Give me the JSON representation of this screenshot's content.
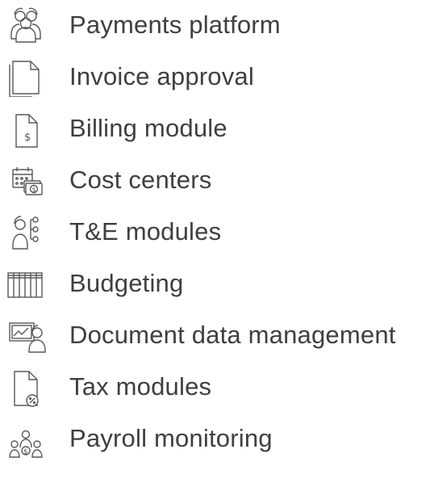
{
  "items": [
    {
      "label": "Payments platform",
      "icon": "people-group-icon"
    },
    {
      "label": "Invoice approval",
      "icon": "documents-icon"
    },
    {
      "label": "Billing module",
      "icon": "dollar-document-icon"
    },
    {
      "label": "Cost centers",
      "icon": "calendar-money-icon"
    },
    {
      "label": "T&E modules",
      "icon": "person-network-icon"
    },
    {
      "label": "Budgeting",
      "icon": "spreadsheet-grid-icon"
    },
    {
      "label": "Document data management",
      "icon": "chart-person-icon"
    },
    {
      "label": "Tax modules",
      "icon": "document-percent-icon"
    },
    {
      "label": "Payroll monitoring",
      "icon": "team-money-icon"
    }
  ],
  "colors": {
    "icon_stroke": "#595959",
    "text": "#3f3f3f",
    "background": "#ffffff"
  }
}
